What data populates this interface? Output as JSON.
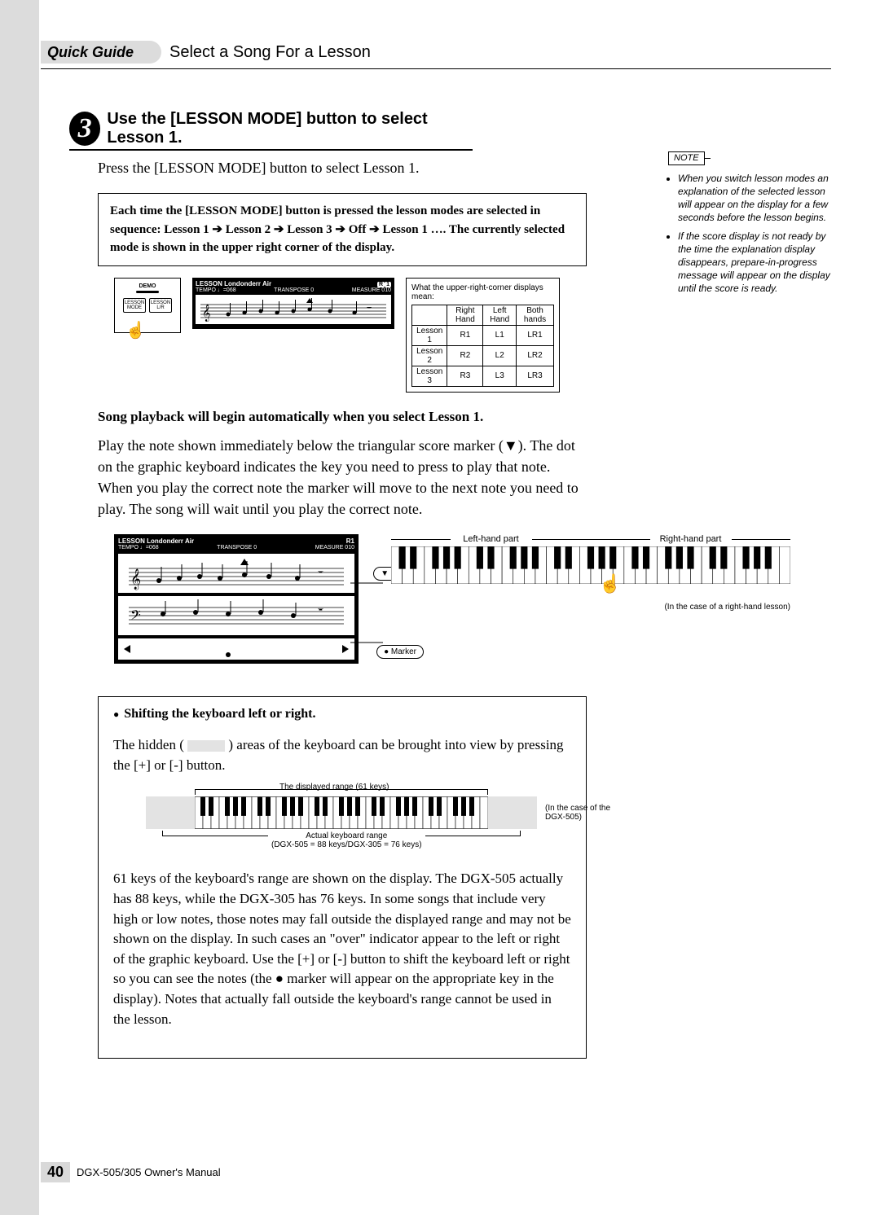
{
  "header": {
    "tab": "Quick Guide",
    "title": "Select a Song For a Lesson"
  },
  "step": {
    "number": "3",
    "title": "Use the [LESSON MODE] button to select Lesson 1.",
    "intro": "Press the [LESSON MODE] button to select Lesson 1.",
    "infobox": "Each time the [LESSON MODE] button is pressed the lesson modes are selected in sequence: Lesson 1 ➔ Lesson 2 ➔ Lesson 3 ➔ Off ➔ Lesson 1 ….  The currently selected mode is shown in the upper right corner of the display."
  },
  "demo": {
    "label": "DEMO",
    "btn1_top": "LESSON",
    "btn1_bot": "MODE",
    "btn2_top": "LESSON",
    "btn2_bot": "L/R"
  },
  "lcd": {
    "toprow_left": "LESSON",
    "toprow_right": "Londonderr Air",
    "tempo": "TEMPO ♩=068",
    "transpose": "TRANSPOSE    0",
    "measure": "MEASURE 010",
    "badge_r": "R",
    "badge_1": "1"
  },
  "minitable": {
    "caption": "What the upper-right-corner displays mean:",
    "cols": [
      "",
      "Right Hand",
      "Left Hand",
      "Both hands"
    ],
    "rows": [
      [
        "Lesson 1",
        "R1",
        "L1",
        "LR1"
      ],
      [
        "Lesson 2",
        "R2",
        "L2",
        "LR2"
      ],
      [
        "Lesson 3",
        "R3",
        "L3",
        "LR3"
      ]
    ]
  },
  "note": {
    "label": "NOTE",
    "items": [
      "When you switch lesson modes an explanation of the selected lesson will appear on the display for a few seconds before the lesson begins.",
      "If the score display is not ready by the time the explanation display disappears, prepare-in-progress message will appear on the display until the score is ready."
    ]
  },
  "playback": {
    "heading": "Song playback will begin automatically when you select Lesson 1.",
    "body": "Play the note shown immediately below the triangular score marker (▼). The dot on the graphic keyboard indicates the key you need to press to play that note. When you play the correct note the marker will move to the next note you need to play. The song will wait until you play the correct note."
  },
  "fig2": {
    "marker_top": "▼ Marker",
    "marker_bot": "● Marker",
    "left_label": "Left-hand part",
    "right_label": "Right-hand part",
    "caption": "(In the case of a right-hand lesson)"
  },
  "shiftbox": {
    "heading": "Shifting the keyboard left or right.",
    "line1a": "The hidden (",
    "line1b": ") areas of the keyboard can be brought into view by pressing the [+] or [-] button.",
    "label_top": "The displayed range (61 keys)",
    "label_bot_1": "Actual keyboard range",
    "label_bot_2": "(DGX-505 = 88 keys/DGX-305 = 76 keys)",
    "sidecap": "(In the case of the DGX-505)",
    "para": "61 keys of the keyboard's range are shown on the display. The DGX-505 actually has 88 keys, while the DGX-305 has 76 keys. In some songs that include very high or low notes, those notes may fall outside the displayed range and may not be shown on the display. In such cases an \"over\" indicator appear to the left or right of the graphic keyboard. Use the [+] or [-] button to shift the keyboard left or right so you can see the notes (the ● marker will appear on the appropriate key in the display). Notes that actually fall outside the keyboard's range cannot be used in the lesson."
  },
  "footer": {
    "page": "40",
    "manual": "DGX-505/305  Owner's Manual"
  }
}
